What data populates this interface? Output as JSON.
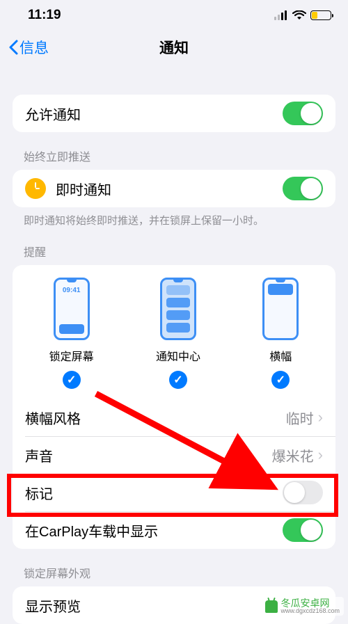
{
  "status": {
    "time": "11:19"
  },
  "nav": {
    "back_label": "信息",
    "title": "通知"
  },
  "allow": {
    "label": "允许通知",
    "on": true
  },
  "timely": {
    "header": "始终立即推送",
    "label": "即时通知",
    "on": true,
    "footer": "即时通知将始终即时推送，并在锁屏上保留一小时。"
  },
  "alerts": {
    "header": "提醒",
    "lock_label": "锁定屏幕",
    "lock_time": "09:41",
    "center_label": "通知中心",
    "banner_label": "横幅",
    "lock_on": true,
    "center_on": true,
    "banner_on": true
  },
  "banner_style": {
    "label": "横幅风格",
    "value": "临时"
  },
  "sound": {
    "label": "声音",
    "value": "爆米花"
  },
  "badge": {
    "label": "标记",
    "on": false
  },
  "carplay": {
    "label": "在CarPlay车载中显示",
    "on": true
  },
  "lockscreen": {
    "header": "锁定屏幕外观",
    "preview_label": "显示预览"
  },
  "watermark": "冬瓜安卓网",
  "watermark_url": "www.dgxcdz168.com"
}
